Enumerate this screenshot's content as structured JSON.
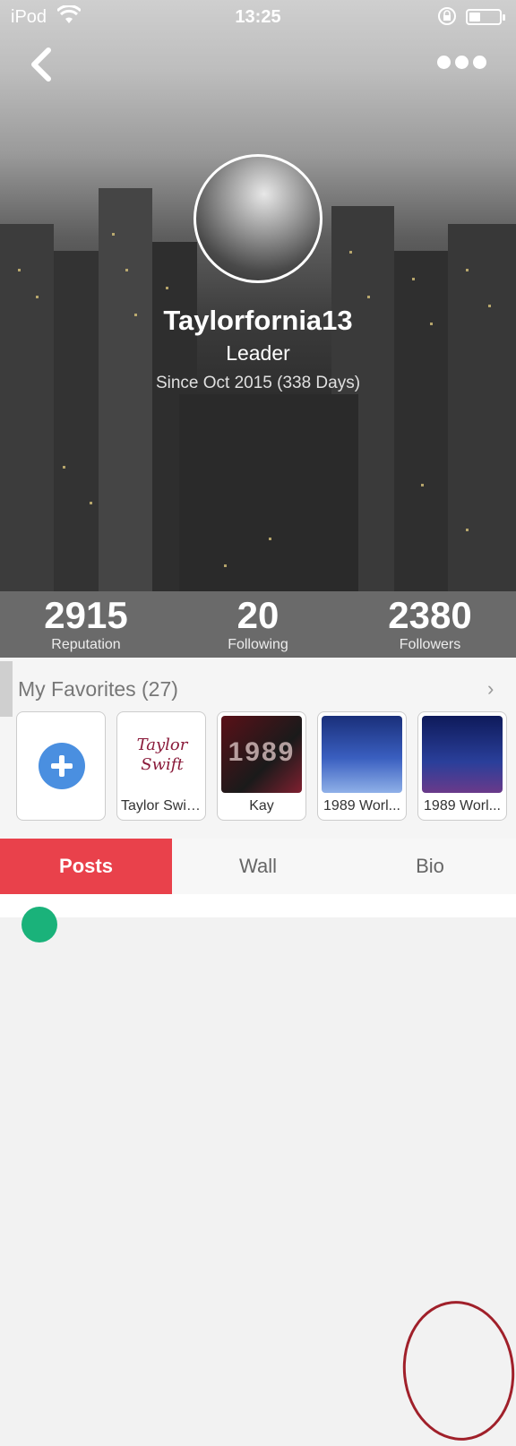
{
  "status_bar": {
    "carrier": "iPod",
    "time": "13:25"
  },
  "profile": {
    "username": "Taylorfornia13",
    "role": "Leader",
    "since": "Since Oct 2015 (338 Days)"
  },
  "stats": [
    {
      "value": "2915",
      "label": "Reputation"
    },
    {
      "value": "20",
      "label": "Following"
    },
    {
      "value": "2380",
      "label": "Followers"
    }
  ],
  "favorites": {
    "title": "My Favorites (27)",
    "items": [
      {
        "caption": "Taylor Swif...",
        "thumb_text": "Taylor Swift"
      },
      {
        "caption": "Kay",
        "thumb_text": "1989"
      },
      {
        "caption": "1989 Worl..."
      },
      {
        "caption": "1989 Worl..."
      }
    ]
  },
  "tabs": [
    {
      "label": "Posts",
      "active": true
    },
    {
      "label": "Wall",
      "active": false
    },
    {
      "label": "Bio",
      "active": false
    }
  ],
  "colors": {
    "accent_red": "#e9414b",
    "add_blue": "#4a8fe0"
  }
}
